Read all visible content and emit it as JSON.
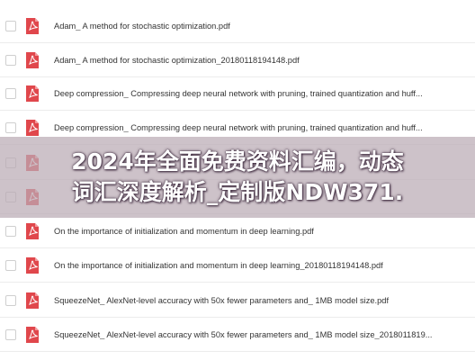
{
  "files": [
    {
      "name": "Adam_ A method for stochastic optimization.pdf"
    },
    {
      "name": "Adam_ A method for stochastic optimization_20180118194148.pdf"
    },
    {
      "name": "Deep compression_ Compressing deep neural network with pruning, trained quantization and huff..."
    },
    {
      "name": "Deep compression_ Compressing deep neural network with pruning, trained quantization and huff..."
    },
    {
      "name": ""
    },
    {
      "name": ""
    },
    {
      "name": "On the importance of initialization and momentum in deep learning.pdf"
    },
    {
      "name": "On the importance of initialization and momentum in deep learning_20180118194148.pdf"
    },
    {
      "name": "SqueezeNet_ AlexNet-level accuracy with 50x fewer parameters and_ 1MB model size.pdf"
    },
    {
      "name": "SqueezeNet_ AlexNet-level accuracy with 50x fewer parameters and_ 1MB model size_2018011819..."
    }
  ],
  "icon": {
    "name": "pdf-icon",
    "color": "#e0474c"
  },
  "banner": {
    "line1": "2024年全面免费资料汇编，动态",
    "line2": "词汇深度解析_定制版NDW371."
  }
}
